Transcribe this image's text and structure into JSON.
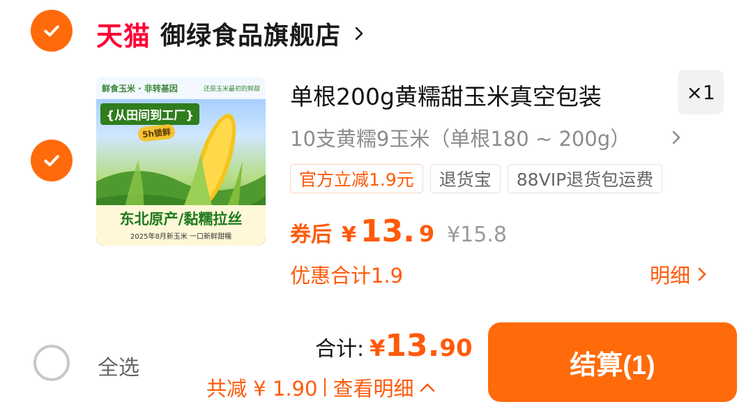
{
  "store": {
    "badge": "天猫",
    "name": "御绿食品旗舰店"
  },
  "product": {
    "image": {
      "top_left": "鲜食玉米 · 非转基因",
      "top_right": "还原玉米最初的鲜甜",
      "banner": "{从田间到工厂}",
      "fresh_badge": "5h锁鲜",
      "headline": "东北原产/黏糯拉丝",
      "subline": "2025年8月新玉米  一口新鲜甜糯"
    },
    "title": "单根200g黄糯甜玉米真空包装",
    "quantity": "×1",
    "sku": "10支黄糯9玉米（单根180 ~ 200g）",
    "tags": [
      "官方立减1.9元",
      "退货宝",
      "88VIP退货包运费"
    ],
    "price_label": "券后",
    "currency": "¥",
    "price_int": "13.",
    "price_dec": "9",
    "original_price": "¥15.8",
    "discount_total": "优惠合计1.9",
    "detail_link": "明细"
  },
  "footer": {
    "select_all": "全选",
    "total_label": "合计:",
    "total_currency": "¥",
    "total_int": "13.",
    "total_dec": "90",
    "saved": "共减 ¥ 1.90",
    "view_detail": "查看明细",
    "checkout": "结算(1)"
  },
  "colors": {
    "accent": "#ff6a0a",
    "tmall_red": "#ff0036"
  }
}
